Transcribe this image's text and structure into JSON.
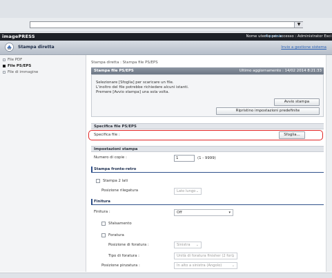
{
  "browser": {
    "address_value": "",
    "dropdown_glyph": "▼"
  },
  "header": {
    "brand": "imagePRESS",
    "portal_link": "A portale",
    "user_info": "Nome utente per accesso : Administrator Esci",
    "page_title": "Stampa diretta",
    "settings_link": "Invio a gestione sistema"
  },
  "sidebar": {
    "items": [
      {
        "label": "File PDF",
        "active": false
      },
      {
        "label": "File PS/EPS",
        "active": true
      },
      {
        "label": "File di immagine",
        "active": false
      }
    ]
  },
  "breadcrumb": "Stampa diretta : Stampa file PS/EPS",
  "section": {
    "title": "Stampa file PS/EPS",
    "last_update": "Ultimo aggiornamento : 14/02 2014 8:21:33",
    "instructions": [
      "Selezionare [Sfoglia] per scaricare un file.",
      "L'inoltro del file potrebbe richiedere alcuni istanti.",
      "Premere [Avvio stampa] una sola volta."
    ],
    "print_button": "Avvio stampa",
    "reset_button": "Ripristino impostazioni predefinite"
  },
  "file_spec": {
    "title": "Specifica file PS/EPS",
    "label": "Specifica file :",
    "browse_button": "Sfoglia..."
  },
  "print_settings": {
    "title": "Impostazioni stampa",
    "copies_label": "Numero di copie :",
    "copies_value": "1",
    "copies_range": "(1 - 9999)"
  },
  "duplex": {
    "title": "Stampa fronte-retro",
    "checkbox_label": "Stampa 2 lati",
    "binding_label": "Posizione rilegatura",
    "binding_value": "Lato lungo"
  },
  "finishing": {
    "title": "Finitura",
    "label": "Finitura :",
    "value": "Off",
    "offset_label": "Sfalsamento",
    "punch_label": "Foratura",
    "punch_position_label": "Posizione di foratura :",
    "punch_position_value": "Sinistra",
    "punch_type_label": "Tipo di foratura :",
    "punch_type_value": "Unità di foratura finisher (2 fori)",
    "staple_position_label": "Posizione pinzatura :",
    "staple_position_value": "In alto a sinistra (Angolo)"
  },
  "colors": {
    "highlight": "#e02323",
    "accent": "#2d4f8a",
    "topbar": "#1e2127",
    "link": "#2a62b7"
  }
}
